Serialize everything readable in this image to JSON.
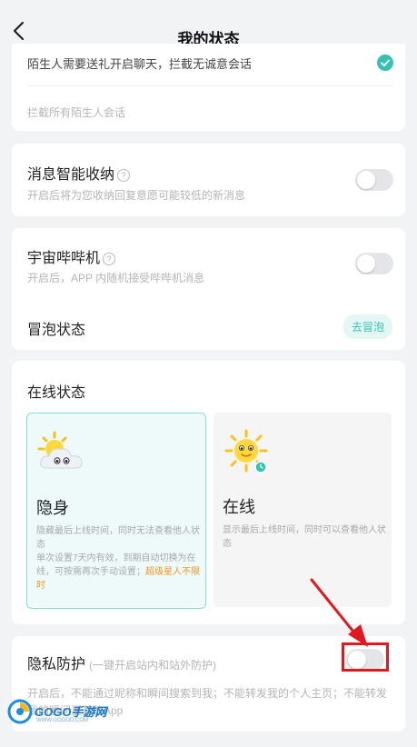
{
  "header": {
    "title": "我的状态"
  },
  "stranger": {
    "top_text": "陌生人需要送礼开启聊天，拦截无诚意会话",
    "bottom_text": "拦截所有陌生人会话"
  },
  "smart_fold": {
    "title": "消息智能收纳",
    "desc": "开启后将为您收纳回复意愿可能较低的新消息",
    "enabled": false
  },
  "beeper": {
    "title": "宇宙哔哔机",
    "desc": "开启后，APP 内随机接受哔哔机消息",
    "enabled": false
  },
  "bubble_status": {
    "title": "冒泡状态",
    "button": "去冒泡"
  },
  "online_status": {
    "section_title": "在线状态",
    "options": [
      {
        "title": "隐身",
        "icon": "cloudy-sun-icon",
        "desc_lines": [
          "隐藏最后上线时间，同时无法查看他人状态",
          "单次设置7天内有效，到期自动切换为在线，可按需再次手动设置；"
        ],
        "highlight": "超级星人不限时",
        "selected": true
      },
      {
        "title": "在线",
        "icon": "sun-icon",
        "desc_lines": [
          "显示最后上线时间，同时可以查看他人状态"
        ],
        "selected": false
      }
    ]
  },
  "privacy": {
    "title": "隐私防护",
    "hint": "(一键开启站内和站外防护)",
    "desc": "开启后，不能通过昵称和瞬间搜索到我；不能转发我的个人主页；不能转发我的瞬间至其他App",
    "enabled": false
  },
  "watermark": {
    "text": "GOGO手游网",
    "sub": "WWW.GOGOD.COM"
  },
  "colors": {
    "accent": "#35c1b1",
    "annotation": "#e0191e",
    "highlight": "#f19722"
  }
}
